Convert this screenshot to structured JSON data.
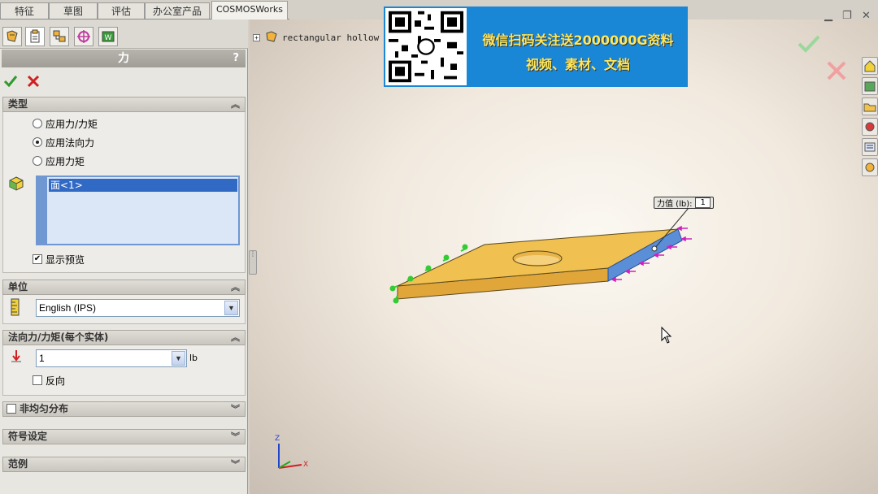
{
  "tabs": [
    "特征",
    "草图",
    "评估",
    "办公室产品",
    "COSMOSWorks"
  ],
  "property_manager": {
    "title": "力",
    "help": "?",
    "type_section": {
      "header": "类型",
      "options": [
        "应用力/力矩",
        "应用法向力",
        "应用力矩"
      ],
      "selected_index": 1,
      "selection_item": "面<1>",
      "show_preview_label": "显示预览",
      "show_preview_checked": true
    },
    "units_section": {
      "header": "单位",
      "value": "English (IPS)"
    },
    "force_section": {
      "header": "法向力/力矩(每个实体)",
      "value": "1",
      "unit": "lb",
      "reverse_label": "反向",
      "reverse_checked": false
    },
    "nonuniform_section": {
      "header": "非均匀分布"
    },
    "symbol_section": {
      "header": "符号设定"
    },
    "example_section": {
      "header": "范例"
    }
  },
  "graphics": {
    "tree_item": "rectangular hollow p",
    "banner_line1": "微信扫码关注送2000000G资料",
    "banner_line2": "视频、素材、文档",
    "callout_label": "力值 (lb):",
    "callout_value": "1",
    "triad": {
      "z": "Z",
      "x": "X"
    }
  },
  "colors": {
    "accent": "#316ac5",
    "plate": "#f0c050",
    "selected_face": "#5a8fd8",
    "force_arrow": "#d020c0",
    "fixture": "#33cc33",
    "banner": "#1a86d6",
    "banner_text": "#ffe65a"
  },
  "icons": [
    "feature-manager-icon",
    "property-manager-icon",
    "configuration-manager-icon",
    "dimxpert-icon",
    "cosmos-manager-icon",
    "ok-check-icon",
    "cancel-x-icon",
    "collapse-chevron-icon",
    "expand-chevron-icon",
    "face-selection-icon",
    "units-ruler-icon",
    "normal-force-icon",
    "part-icon"
  ]
}
